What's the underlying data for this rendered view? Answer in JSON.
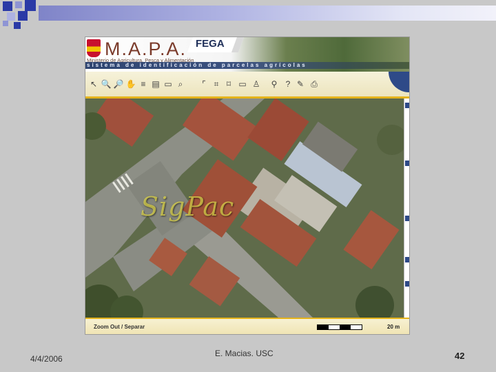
{
  "slide": {
    "date": "4/4/2006",
    "author": "E. Macias. USC",
    "page_number": "42",
    "accent_colors": [
      "#2b3aa6",
      "#7f84c8",
      "#e4b31a"
    ]
  },
  "app": {
    "header": {
      "logo_title": "M.A.P.A.",
      "ministry_subtitle": "Ministerio de Agricultura, Pesca y Alimentación",
      "agency": "FEGA",
      "system_name": "sistema de identificación de parcelas agrícolas"
    },
    "toolbar": {
      "buttons": [
        {
          "icon": "select-arrow-icon",
          "glyph": "↖"
        },
        {
          "icon": "zoom-in-icon",
          "glyph": "🔍"
        },
        {
          "icon": "zoom-out-icon",
          "glyph": "🔎"
        },
        {
          "icon": "pan-hand-icon",
          "glyph": "✋"
        },
        {
          "icon": "layers-icon",
          "glyph": "≡"
        },
        {
          "icon": "legend-icon",
          "glyph": "▤"
        },
        {
          "icon": "open-folder-icon",
          "glyph": "▭"
        },
        {
          "icon": "binoculars-search-icon",
          "glyph": "⌕"
        },
        {
          "icon": "draw-point-icon",
          "glyph": "⌜"
        },
        {
          "icon": "draw-line-icon",
          "glyph": "⌗"
        },
        {
          "icon": "draw-polygon-icon",
          "glyph": "⌑"
        },
        {
          "icon": "erase-icon",
          "glyph": "▭"
        },
        {
          "icon": "user-icon",
          "glyph": "♙"
        },
        {
          "icon": "find-icon",
          "glyph": "⚲"
        },
        {
          "icon": "help-icon",
          "glyph": "?"
        },
        {
          "icon": "tools-icon",
          "glyph": "✎"
        },
        {
          "icon": "print-icon",
          "glyph": "⎙"
        }
      ]
    },
    "map": {
      "watermark": "SigPac"
    },
    "status": {
      "action_label": "Zoom Out / Separar",
      "scale_label": "20 m"
    }
  }
}
